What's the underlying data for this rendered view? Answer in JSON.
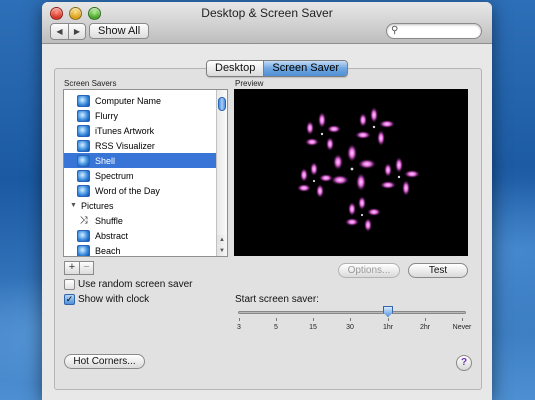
{
  "window": {
    "title": "Desktop & Screen Saver",
    "back_glyph": "◀",
    "forward_glyph": "▶",
    "show_all": "Show All",
    "search_placeholder": "",
    "search_icon": "magnifier-icon"
  },
  "tabs": [
    {
      "label": "Desktop",
      "active": false
    },
    {
      "label": "Screen Saver",
      "active": true
    }
  ],
  "screen_savers": {
    "heading": "Screen Savers",
    "items": [
      {
        "label": "Computer Name",
        "icon": "screensaver-icon"
      },
      {
        "label": "Flurry",
        "icon": "screensaver-icon"
      },
      {
        "label": "iTunes Artwork",
        "icon": "screensaver-icon"
      },
      {
        "label": "RSS Visualizer",
        "icon": "screensaver-icon"
      },
      {
        "label": "Shell",
        "icon": "screensaver-icon",
        "selected": true
      },
      {
        "label": "Spectrum",
        "icon": "screensaver-icon"
      },
      {
        "label": "Word of the Day",
        "icon": "screensaver-icon"
      }
    ],
    "group": {
      "label": "Pictures",
      "expanded": true
    },
    "group_items": [
      {
        "label": "Shuffle",
        "icon": "shuffle-icon"
      },
      {
        "label": "Abstract",
        "icon": "screensaver-icon"
      },
      {
        "label": "Beach",
        "icon": "screensaver-icon"
      }
    ],
    "add_label": "+",
    "remove_label": "−"
  },
  "preview": {
    "heading": "Preview",
    "options_button": "Options...",
    "test_button": "Test"
  },
  "options": {
    "random": {
      "label": "Use random screen saver",
      "checked": false
    },
    "clock": {
      "label": "Show with clock",
      "checked": true,
      "check_glyph": "✓"
    }
  },
  "start": {
    "label": "Start screen saver:",
    "ticks": [
      "3",
      "5",
      "15",
      "30",
      "1hr",
      "2hr",
      "Never"
    ],
    "selected_tick": "1hr"
  },
  "hot_corners_button": "Hot Corners...",
  "help_glyph": "?",
  "colors": {
    "selection": "#3875d7",
    "accent": "#4f8fd5"
  }
}
